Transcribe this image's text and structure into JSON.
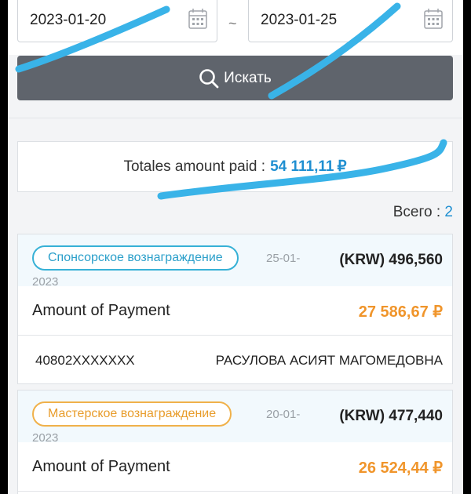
{
  "filter": {
    "date_from": "2023-01-20",
    "separator": "~",
    "date_to": "2023-01-25",
    "search_label": "Искать"
  },
  "summary": {
    "label": "Totales amount paid :",
    "amount": "54 111,11",
    "currency": "₽"
  },
  "count": {
    "label": "Всего :",
    "value": "2"
  },
  "payments": [
    {
      "type": "Спонсорское вознаграждение",
      "date_part": "25-01-",
      "date_year": "2023",
      "krw": "(KRW) 496,560",
      "amount_label": "Amount of Payment",
      "amount": "27 586,67 ₽",
      "account": "40802XXXXXXX",
      "recipient": "РАСУЛОВА АСИЯТ МАГОМЕДОВНА"
    },
    {
      "type": "Мастерское вознаграждение",
      "date_part": "20-01-",
      "date_year": "2023",
      "krw": "(KRW) 477,440",
      "amount_label": "Amount of Payment",
      "amount": "26 524,44 ₽"
    }
  ],
  "colors": {
    "accent": "#1f8fd1",
    "button": "#5f646c",
    "amount": "#f0952b",
    "sponsor_badge": "#37b1d6",
    "master_badge": "#f0b14a",
    "scribble": "#39b3e8"
  }
}
